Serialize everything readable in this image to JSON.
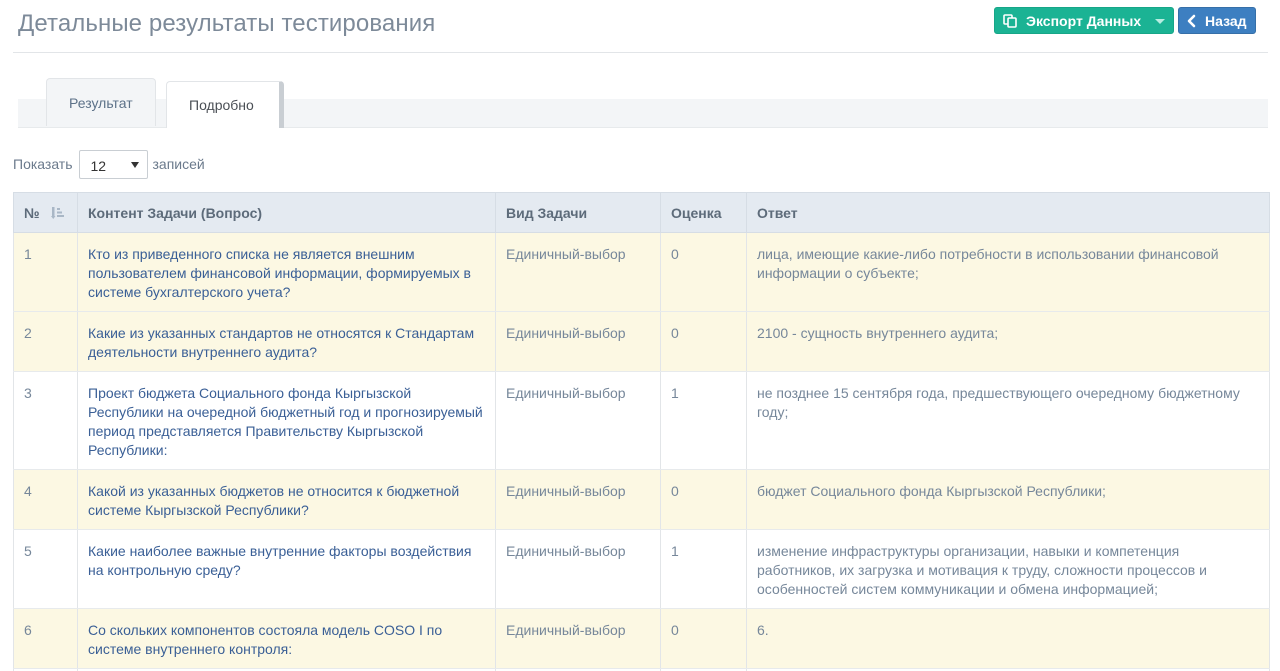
{
  "header": {
    "title": "Детальные результаты тестирования",
    "export_label": "Экспорт Данных",
    "back_label": "Назад"
  },
  "tabs": [
    {
      "label": "Результат"
    },
    {
      "label": "Подробно"
    }
  ],
  "length_control": {
    "show_label": "Показать",
    "selected": "12",
    "entries_label": "записей"
  },
  "table": {
    "columns": [
      "№",
      "Контент Задачи (Вопрос)",
      "Вид Задачи",
      "Оценка",
      "Ответ"
    ],
    "rows": [
      {
        "num": "1",
        "question": "Кто из приведенного списка не является внешним пользователем финансовой информации, формируемых в системе бухгалтерского учета?",
        "type": "Единичный-выбор",
        "score": "0",
        "answer": "лица, имеющие какие-либо потребности в использовании финансовой информации о субъекте;"
      },
      {
        "num": "2",
        "question": "Какие из указанных стандартов не относятся к Стандартам деятельности внутреннего аудита?",
        "type": "Единичный-выбор",
        "score": "0",
        "answer": "2100 - сущность внутреннего аудита;"
      },
      {
        "num": "3",
        "question": "Проект бюджета Социального фонда Кыргызской Республики на очередной бюджетный год и прогнозируемый период представляется Правительству Кыргызской Республики:",
        "type": "Единичный-выбор",
        "score": "1",
        "answer": "не позднее 15 сентября года, предшествующего очередному бюджетному году;"
      },
      {
        "num": "4",
        "question": "Какой из указанных бюджетов не относится к бюджетной системе Кыргызской Республики?",
        "type": "Единичный-выбор",
        "score": "0",
        "answer": "бюджет Социального фонда Кыргызской Республики;"
      },
      {
        "num": "5",
        "question": "Какие наиболее важные внутренние факторы воздействия на контрольную среду?",
        "type": "Единичный-выбор",
        "score": "1",
        "answer": "изменение инфраструктуры организации, навыки и компетенция работников, их загрузка и мотивация к труду, сложности процессов и особенностей систем коммуникации и обмена информацией;"
      },
      {
        "num": "6",
        "question": "Со скольких компонентов состояла модель COSO I по системе внутреннего контроля:",
        "type": "Единичный-выбор",
        "score": "0",
        "answer": "6."
      },
      {
        "num": "",
        "question": "",
        "type": "",
        "score": "",
        "answer": ""
      }
    ]
  }
}
